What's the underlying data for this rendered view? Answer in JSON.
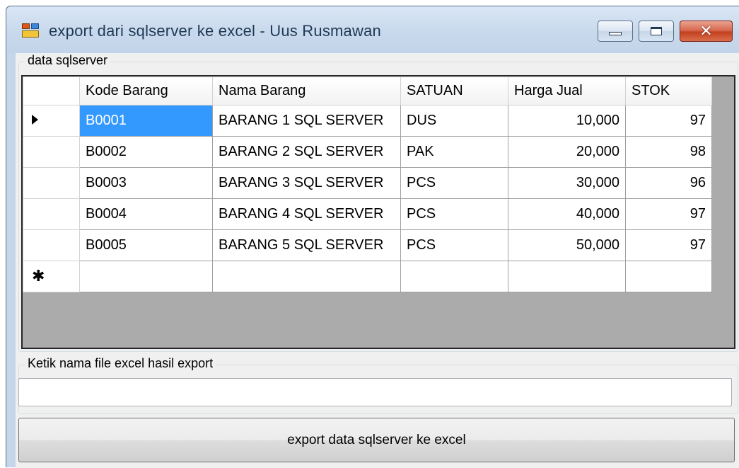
{
  "window": {
    "title": "export dari sqlserver ke excel - Uus Rusmawan",
    "minimize_icon": "minimize-icon",
    "maximize_icon": "maximize-icon",
    "close_icon": "close-icon",
    "close_glyph": "✕"
  },
  "data_group": {
    "label": "data sqlserver",
    "grid": {
      "columns": [
        "Kode Barang",
        "Nama Barang",
        "SATUAN",
        "Harga Jual",
        "STOK"
      ],
      "rows": [
        [
          "B0001",
          "BARANG 1 SQL SERVER",
          "DUS",
          "10,000",
          "97"
        ],
        [
          "B0002",
          "BARANG 2 SQL SERVER",
          "PAK",
          "20,000",
          "98"
        ],
        [
          "B0003",
          "BARANG 3 SQL SERVER",
          "PCS",
          "30,000",
          "96"
        ],
        [
          "B0004",
          "BARANG 4 SQL SERVER",
          "PCS",
          "40,000",
          "97"
        ],
        [
          "B0005",
          "BARANG 5 SQL SERVER",
          "PCS",
          "50,000",
          "97"
        ]
      ],
      "selected_cell": "B0001",
      "current_row_icon": "row-pointer-icon",
      "new_row_marker": "✱",
      "selection_color": "#3399ff"
    }
  },
  "file_group": {
    "label": "Ketik nama file excel hasil export",
    "input_value": ""
  },
  "export_button": {
    "label": "export data sqlserver ke excel"
  }
}
